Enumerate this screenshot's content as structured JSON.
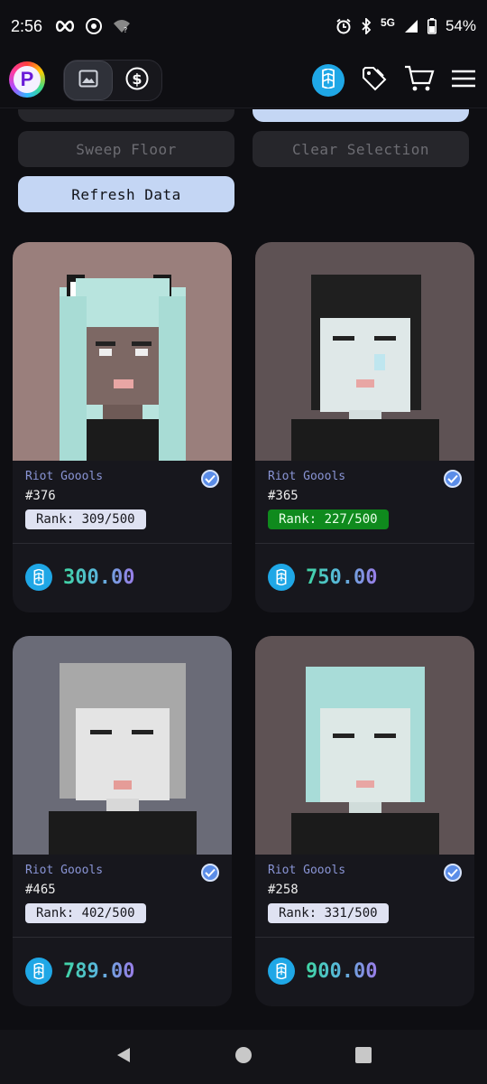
{
  "status_bar": {
    "time": "2:56",
    "network": "5G",
    "battery": "54%"
  },
  "header": {
    "logo_letter": "P",
    "icons": [
      "image-icon",
      "dollar-icon",
      "fantom-icon",
      "tag-icon",
      "cart-icon",
      "menu-icon"
    ]
  },
  "actions": {
    "sweep_label": "Sweep Floor",
    "clear_label": "Clear Selection",
    "refresh_label": "Refresh Data"
  },
  "cards": [
    {
      "collection": "Riot Goools",
      "token_id": "#376",
      "rank": "Rank: 309/500",
      "price": "300.00",
      "rank_style": "normal"
    },
    {
      "collection": "Riot Goools",
      "token_id": "#365",
      "rank": "Rank: 227/500",
      "price": "750.00",
      "rank_style": "green"
    },
    {
      "collection": "Riot Goools",
      "token_id": "#465",
      "rank": "Rank: 402/500",
      "price": "789.00",
      "rank_style": "normal"
    },
    {
      "collection": "Riot Goools",
      "token_id": "#258",
      "rank": "Rank: 331/500",
      "price": "900.00",
      "rank_style": "normal"
    }
  ],
  "colors": {
    "background": "#0e0e12",
    "card": "#17171d",
    "primary_button": "#c4d6f4",
    "rank_green": "#0f8a1d",
    "fantom_blue": "#1fa7e6"
  }
}
